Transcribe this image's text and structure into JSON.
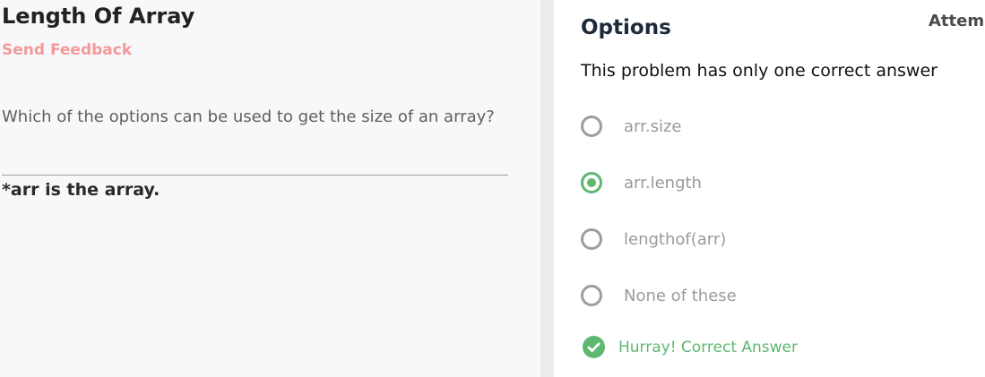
{
  "problem": {
    "title": "Length Of Array",
    "feedback_label": "Send Feedback",
    "question": "Which of the options can be used to get the size of an array?",
    "note": "*arr is the array."
  },
  "options_panel": {
    "heading": "Options",
    "attempt_label": "Attemp",
    "instruction": "This problem has only one correct answer",
    "options": [
      {
        "label": "arr.size",
        "selected": false
      },
      {
        "label": "arr.length",
        "selected": true
      },
      {
        "label": "lengthof(arr)",
        "selected": false
      },
      {
        "label": "None of these",
        "selected": false
      }
    ],
    "result": {
      "icon": "check-circle-icon",
      "text": "Hurray! Correct Answer"
    }
  },
  "colors": {
    "feedback": "#f29a9a",
    "correct": "#5fb870",
    "radio_border": "#9d9d9d",
    "left_bg": "#f8f8fa"
  }
}
